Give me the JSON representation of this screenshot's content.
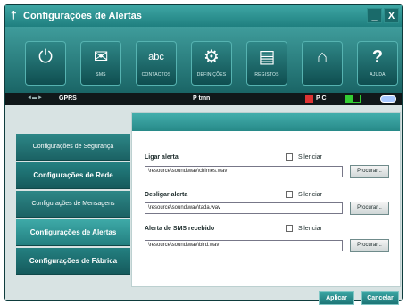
{
  "window": {
    "title": "Configurações de Alertas",
    "minimize_label": "_",
    "close_label": "X"
  },
  "toolbar": {
    "items": [
      {
        "icon": "power-icon",
        "glyph": "⏻",
        "label": ""
      },
      {
        "icon": "sms-envelope-icon",
        "glyph": "✉",
        "label": "SMS"
      },
      {
        "icon": "contacts-icon",
        "glyph": "abc",
        "label": "CONTACTOS"
      },
      {
        "icon": "settings-icon",
        "glyph": "⚙",
        "label": "DEFINIÇÕES"
      },
      {
        "icon": "records-icon",
        "glyph": "▤",
        "label": "REGISTOS"
      },
      {
        "icon": "home-icon",
        "glyph": "⌂",
        "label": ""
      },
      {
        "icon": "help-icon",
        "glyph": "?",
        "label": "AJUDA"
      }
    ]
  },
  "status": {
    "network": "GPRS",
    "operator": "P tmn",
    "pc_label": "P C"
  },
  "sidebar": {
    "items": [
      {
        "label": "Configurações de Segurança",
        "style": "normal"
      },
      {
        "label": "Configurações de Rede",
        "style": "bold"
      },
      {
        "label": "Configurações de Mensagens",
        "style": "normal"
      },
      {
        "label": "Configurações de Alertas",
        "style": "active"
      },
      {
        "label": "Configurações de Fábrica",
        "style": "bold"
      }
    ]
  },
  "alerts": {
    "rows": [
      {
        "label": "Ligar alerta",
        "silence_label": "Silenciar",
        "silenced": false,
        "path": "\\resource\\sound\\wav\\chimes.wav",
        "browse_label": "Procurar..."
      },
      {
        "label": "Desligar alerta",
        "silence_label": "Silenciar",
        "silenced": false,
        "path": "\\resource\\sound\\wav\\tada.wav",
        "browse_label": "Procurar..."
      },
      {
        "label": "Alerta de SMS recebido",
        "silence_label": "Silenciar",
        "silenced": false,
        "path": "\\resource\\sound\\wav\\bird.wav",
        "browse_label": "Procurar..."
      }
    ]
  },
  "footer": {
    "apply_label": "Aplicar",
    "cancel_label": "Cancelar"
  },
  "colors": {
    "accent": "#2b8c8b",
    "dark_teal": "#1f6f71"
  }
}
